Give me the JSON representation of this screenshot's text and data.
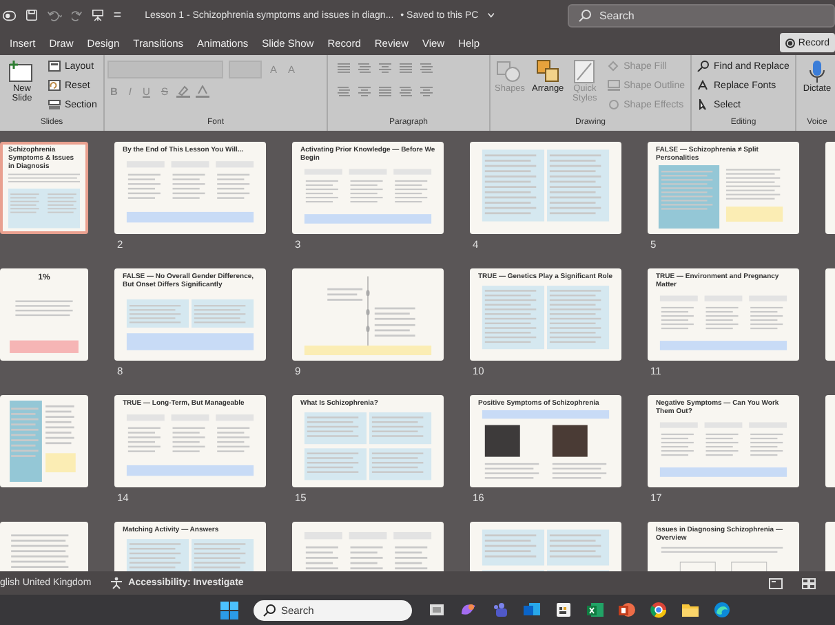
{
  "title_bar": {
    "document_title": "Lesson 1 - Schizophrenia symptoms and issues in diagn...",
    "save_status": "• Saved to this PC",
    "search_placeholder": "Search"
  },
  "ribbon_tabs": [
    {
      "label": "Insert",
      "selected": false
    },
    {
      "label": "Draw",
      "selected": false
    },
    {
      "label": "Design",
      "selected": false
    },
    {
      "label": "Transitions",
      "selected": false
    },
    {
      "label": "Animations",
      "selected": false
    },
    {
      "label": "Slide Show",
      "selected": false
    },
    {
      "label": "Record",
      "selected": false
    },
    {
      "label": "Review",
      "selected": false
    },
    {
      "label": "View",
      "selected": false
    },
    {
      "label": "Help",
      "selected": false
    }
  ],
  "record_button": "Record",
  "ribbon_groups": [
    {
      "kind": "slides",
      "label": "Slides",
      "large": [
        {
          "label": "New Slide",
          "disabled": false
        }
      ],
      "small": [
        {
          "label": "Layout",
          "disabled": false
        },
        {
          "label": "Reset",
          "disabled": false
        },
        {
          "label": "Section",
          "disabled": false
        }
      ]
    },
    {
      "kind": "font",
      "label": "Font",
      "rows": [
        [
          {
            "label": "A",
            "disabled": true
          },
          {
            "label": "A",
            "disabled": true
          }
        ],
        [
          {
            "label": "B",
            "disabled": true
          },
          {
            "label": "I",
            "disabled": true
          },
          {
            "label": "U",
            "disabled": true
          },
          {
            "label": "S",
            "disabled": true
          }
        ]
      ]
    },
    {
      "kind": "paragraph",
      "label": "Paragraph"
    },
    {
      "kind": "drawing",
      "label": "Drawing",
      "large": [
        {
          "label": "Shapes",
          "disabled": true
        },
        {
          "label": "Arrange",
          "disabled": false
        },
        {
          "label": "Quick Styles",
          "disabled": true
        }
      ],
      "small": [
        {
          "label": "Shape Fill",
          "disabled": true
        },
        {
          "label": "Shape Outline",
          "disabled": true
        },
        {
          "label": "Shape Effects",
          "disabled": true
        }
      ]
    },
    {
      "kind": "editing",
      "label": "Editing",
      "small": [
        {
          "label": "Find and Replace",
          "disabled": false
        },
        {
          "label": "Replace Fonts",
          "disabled": false
        },
        {
          "label": "Select",
          "disabled": false
        }
      ]
    },
    {
      "kind": "voice",
      "label": "Voice",
      "large": [
        {
          "label": "Dictate",
          "disabled": false
        }
      ]
    }
  ],
  "slides": [
    {
      "title": "Schizophrenia Symptoms & Issues in Diagnosis",
      "kind": "title",
      "selected": true
    },
    {
      "number": "2",
      "title": "By the End of This Lesson You Will...",
      "kind": "cards",
      "selected": false
    },
    {
      "number": "3",
      "title": "Activating Prior Knowledge — Before We Begin",
      "kind": "cards",
      "selected": false
    },
    {
      "number": "4",
      "kind": "table",
      "selected": false
    },
    {
      "number": "5",
      "title": "FALSE — Schizophrenia ≠ Split Personalities",
      "kind": "split",
      "selected": false
    },
    {
      "kind": "edge",
      "selected": false
    },
    {
      "figure": "1%",
      "kind": "stat",
      "selected": false
    },
    {
      "number": "8",
      "title": "FALSE — No Overall Gender Difference, But Onset Differs Significantly",
      "kind": "two-panel",
      "selected": false
    },
    {
      "number": "9",
      "kind": "timeline",
      "selected": false
    },
    {
      "number": "10",
      "title": "TRUE — Genetics Play a Significant Role",
      "kind": "table",
      "selected": false
    },
    {
      "number": "11",
      "title": "TRUE — Environment and Pregnancy Matter",
      "kind": "cards",
      "selected": false
    },
    {
      "kind": "edge",
      "selected": false
    },
    {
      "kind": "split",
      "selected": false
    },
    {
      "number": "14",
      "title": "TRUE — Long-Term, But Manageable",
      "kind": "cards",
      "selected": false
    },
    {
      "number": "15",
      "title": "What Is Schizophrenia?",
      "kind": "grid4",
      "selected": false
    },
    {
      "number": "16",
      "title": "Positive Symptoms of Schizophrenia",
      "kind": "photos",
      "selected": false
    },
    {
      "number": "17",
      "title": "Negative Symptoms — Can You Work Them Out?",
      "kind": "cards",
      "selected": false
    },
    {
      "kind": "edge",
      "selected": false
    },
    {
      "kind": "list",
      "selected": false
    },
    {
      "title": "Matching Activity — Answers",
      "kind": "table",
      "selected": false
    },
    {
      "kind": "cards",
      "selected": false
    },
    {
      "kind": "grid4",
      "selected": false
    },
    {
      "title": "Issues in Diagnosing Schizophrenia — Overview",
      "kind": "diagram",
      "selected": false
    },
    {
      "kind": "edge",
      "selected": false
    }
  ],
  "status_bar": {
    "language": "glish United Kingdom",
    "accessibility": "Accessibility: Investigate"
  },
  "taskbar": {
    "search_placeholder": "Search"
  }
}
